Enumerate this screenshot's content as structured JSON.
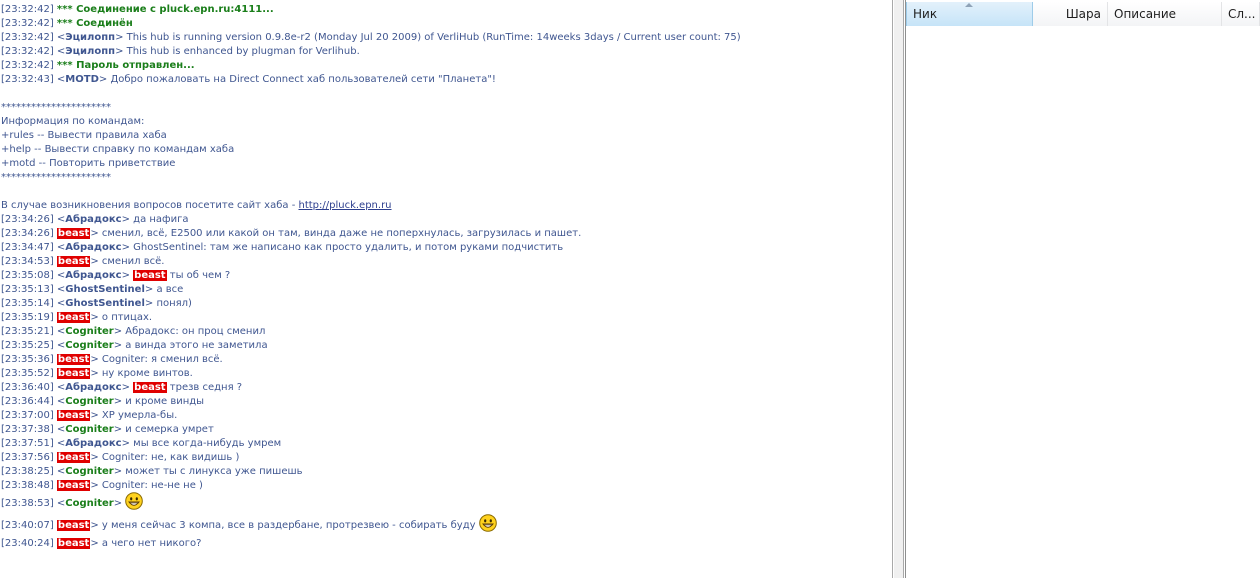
{
  "colors": {
    "timestamp": "#3f5690",
    "system": "#1a7e1a",
    "nick_default": "#3f5690",
    "nick_green": "#1a7e1a",
    "nick_highlight_bg": "#e00000",
    "link": "#2d3f8e"
  },
  "chat_lines": [
    {
      "ts": "[23:32:42]",
      "kind": "sys",
      "text": "*** Соединение с pluck.epn.ru:4111..."
    },
    {
      "ts": "[23:32:42]",
      "kind": "sys",
      "text": "*** Соединён"
    },
    {
      "ts": "[23:32:42]",
      "kind": "msg",
      "nick": "Эцилопп",
      "nick_style": "blue",
      "text": "This hub is running version 0.9.8e-r2 (Monday Jul 20 2009) of VerliHub (RunTime: 14weeks 3days  / Current user count: 75)"
    },
    {
      "ts": "[23:32:42]",
      "kind": "msg",
      "nick": "Эцилопп",
      "nick_style": "blue",
      "text": "This hub is enhanced by plugman for Verlihub."
    },
    {
      "ts": "[23:32:42]",
      "kind": "sys",
      "text": "*** Пароль отправлен..."
    },
    {
      "ts": "[23:32:43]",
      "kind": "msg",
      "nick": "MOTD",
      "nick_style": "blue",
      "text": "Добро пожаловать на Direct Connect хаб пользователей сети \"Планета\"!"
    },
    {
      "kind": "blank"
    },
    {
      "kind": "plain",
      "text": "**********************"
    },
    {
      "kind": "plain",
      "text": "Информация по командам:"
    },
    {
      "kind": "plain",
      "text": "+rules       -- Вывести правила хаба"
    },
    {
      "kind": "plain",
      "text": "+help        -- Вывести справку по командам хаба"
    },
    {
      "kind": "plain",
      "text": "+motd      -- Повторить приветствие"
    },
    {
      "kind": "plain",
      "text": "**********************"
    },
    {
      "kind": "blank"
    },
    {
      "kind": "plain",
      "text": "В случае возникновения вопросов посетите сайт хаба - ",
      "link": "http://pluck.epn.ru"
    },
    {
      "ts": "[23:34:26]",
      "kind": "msg",
      "nick": "Абрадокс",
      "nick_style": "blue",
      "text": "да нафига"
    },
    {
      "ts": "[23:34:26]",
      "kind": "msg",
      "nick": "beast",
      "nick_style": "red",
      "text": "сменил, всё, E2500 или какой он там, винда даже не поперхнулась, загрузилась и пашет."
    },
    {
      "ts": "[23:34:47]",
      "kind": "msg",
      "nick": "Абрадокс",
      "nick_style": "blue",
      "text": "GhostSentinel: там же написано как просто удалить, и потом руками подчистить"
    },
    {
      "ts": "[23:34:53]",
      "kind": "msg",
      "nick": "beast",
      "nick_style": "red",
      "text": "сменил всё."
    },
    {
      "ts": "[23:35:08]",
      "kind": "msg",
      "nick": "Абрадокс",
      "nick_style": "blue",
      "mention": "beast",
      "text": "ты об чем ?"
    },
    {
      "ts": "[23:35:13]",
      "kind": "msg",
      "nick": "GhostSentinel",
      "nick_style": "blue",
      "text": "а все"
    },
    {
      "ts": "[23:35:14]",
      "kind": "msg",
      "nick": "GhostSentinel",
      "nick_style": "blue",
      "text": "понял)"
    },
    {
      "ts": "[23:35:19]",
      "kind": "msg",
      "nick": "beast",
      "nick_style": "red",
      "text": "о птицах."
    },
    {
      "ts": "[23:35:21]",
      "kind": "msg",
      "nick": "Cogniter",
      "nick_style": "green",
      "text": "Абрадокс: он проц сменил"
    },
    {
      "ts": "[23:35:25]",
      "kind": "msg",
      "nick": "Cogniter",
      "nick_style": "green",
      "text": "а винда этого не заметила"
    },
    {
      "ts": "[23:35:36]",
      "kind": "msg",
      "nick": "beast",
      "nick_style": "red",
      "text": "Cogniter: я сменил всё."
    },
    {
      "ts": "[23:35:52]",
      "kind": "msg",
      "nick": "beast",
      "nick_style": "red",
      "text": "ну кроме винтов."
    },
    {
      "ts": "[23:36:40]",
      "kind": "msg",
      "nick": "Абрадокс",
      "nick_style": "blue",
      "mention": "beast",
      "text": "трезв седня ?"
    },
    {
      "ts": "[23:36:44]",
      "kind": "msg",
      "nick": "Cogniter",
      "nick_style": "green",
      "text": "и кроме винды"
    },
    {
      "ts": "[23:37:00]",
      "kind": "msg",
      "nick": "beast",
      "nick_style": "red",
      "text": "XP умерла-бы."
    },
    {
      "ts": "[23:37:38]",
      "kind": "msg",
      "nick": "Cogniter",
      "nick_style": "green",
      "text": "и семерка умрет"
    },
    {
      "ts": "[23:37:51]",
      "kind": "msg",
      "nick": "Абрадокс",
      "nick_style": "blue",
      "text": "мы все когда-нибудь умрем"
    },
    {
      "ts": "[23:37:56]",
      "kind": "msg",
      "nick": "beast",
      "nick_style": "red",
      "text": "Cogniter: не, как видишь )"
    },
    {
      "ts": "[23:38:25]",
      "kind": "msg",
      "nick": "Cogniter",
      "nick_style": "green",
      "text": "может ты с линукса уже пишешь"
    },
    {
      "ts": "[23:38:48]",
      "kind": "msg",
      "nick": "beast",
      "nick_style": "red",
      "text": "Cogniter: не-не не )"
    },
    {
      "ts": "[23:38:53]",
      "kind": "msg",
      "nick": "Cogniter",
      "nick_style": "green",
      "text": "",
      "smiley": "grin-smiley-icon"
    },
    {
      "ts": "[23:40:07]",
      "kind": "msg",
      "nick": "beast",
      "nick_style": "red",
      "text": "у меня сейчас 3 компа, все в раздербане, протрезвею - собирать буду",
      "smiley": "grin-smiley-icon"
    },
    {
      "ts": "[23:40:24]",
      "kind": "msg",
      "nick": "beast",
      "nick_style": "red",
      "text": "а чего нет никого?"
    }
  ],
  "userlist": {
    "columns": [
      {
        "label": "Ник"
      },
      {
        "label": "Шара"
      },
      {
        "label": "Описание"
      },
      {
        "label": "Сл..."
      }
    ]
  }
}
